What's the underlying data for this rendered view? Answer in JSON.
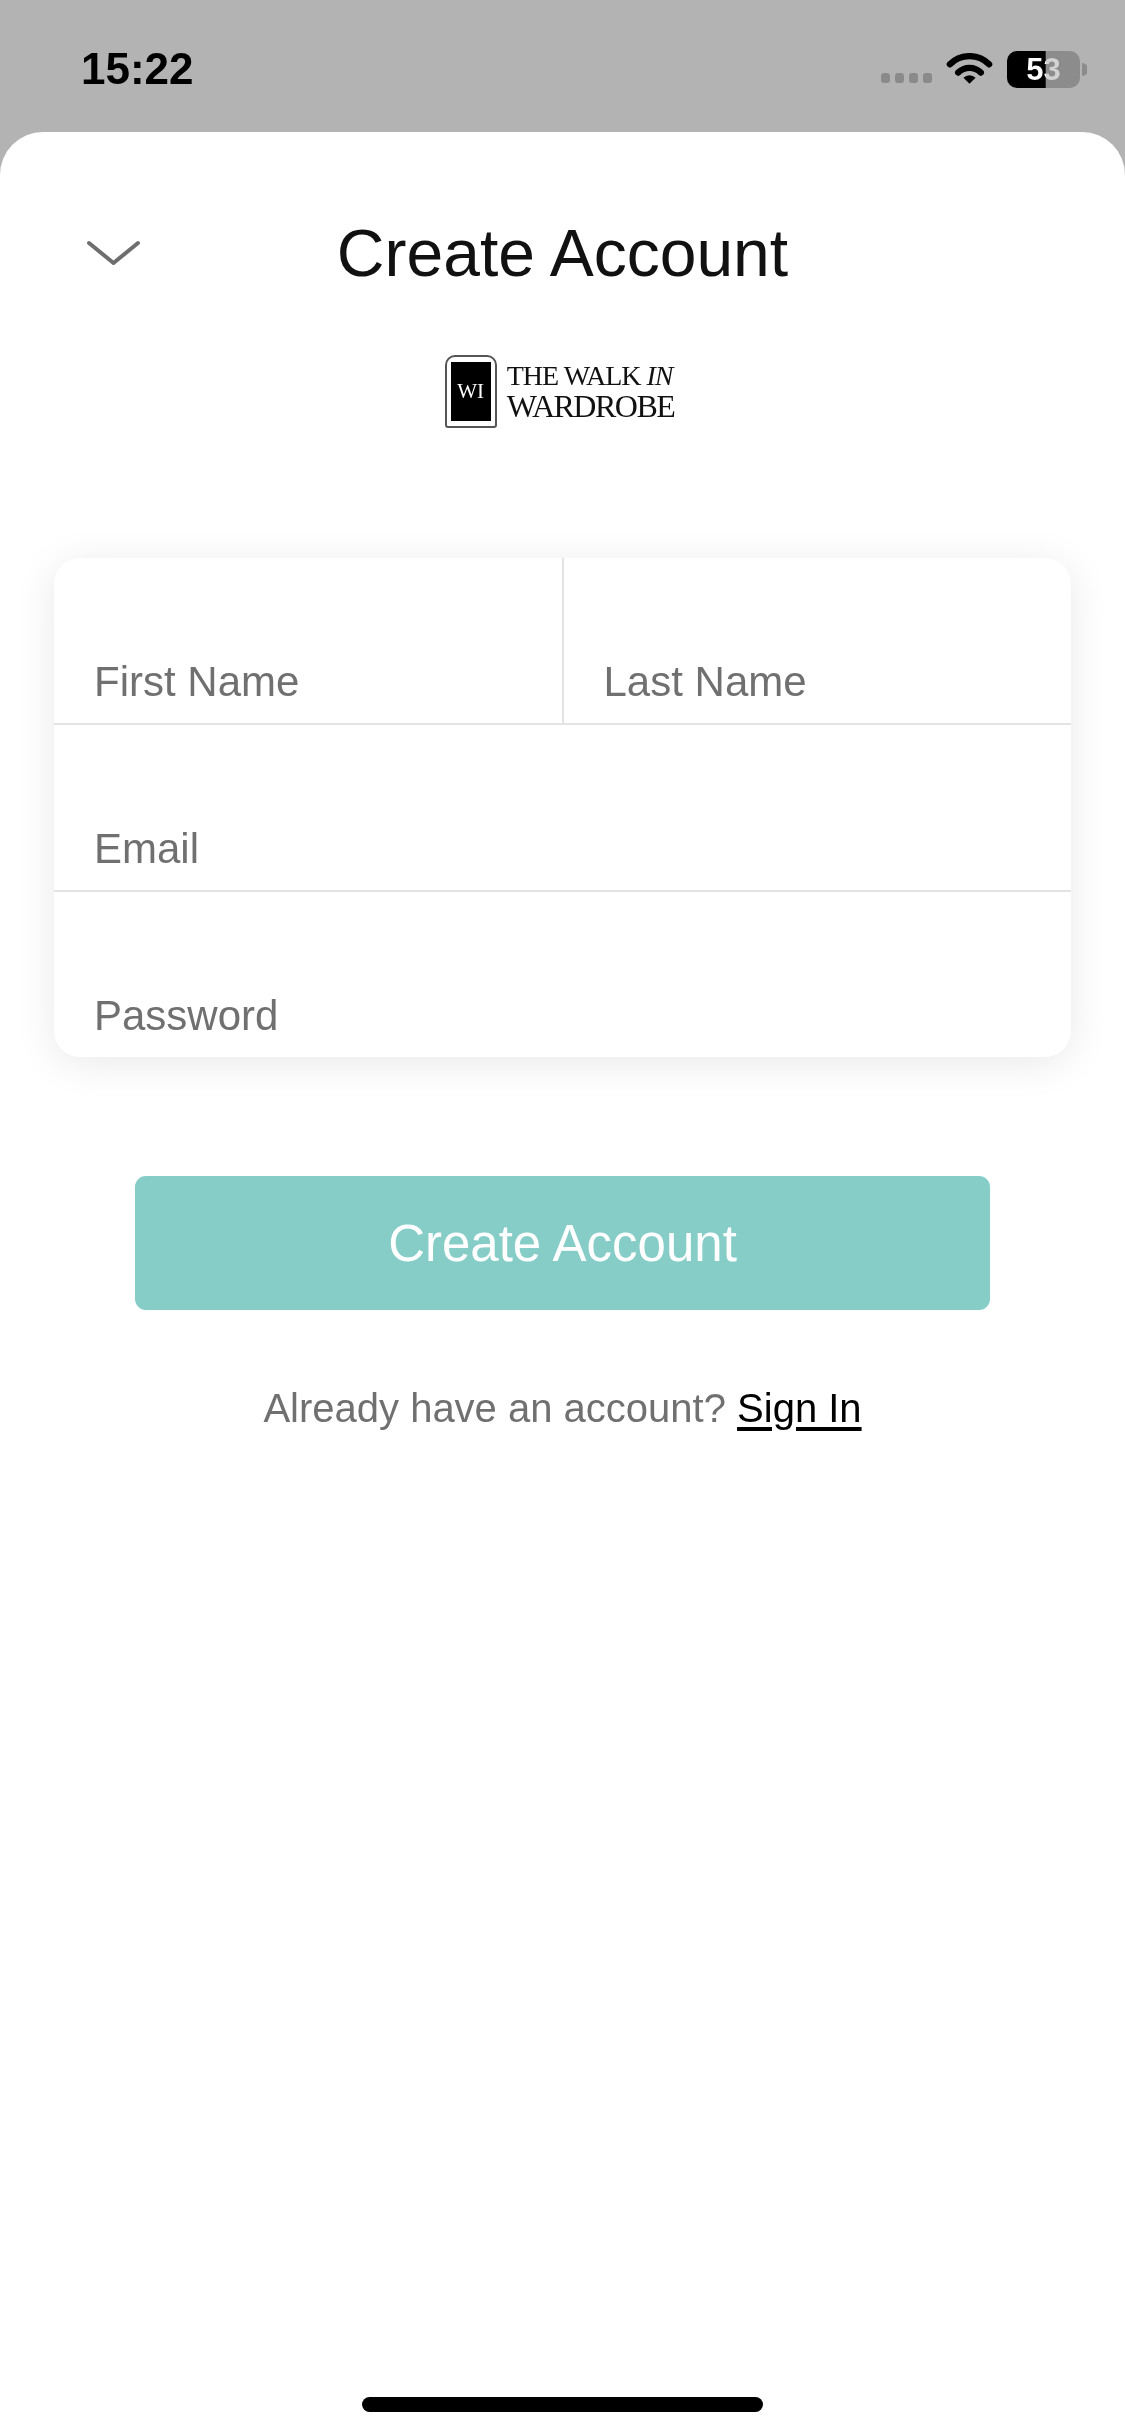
{
  "status_bar": {
    "time": "15:22",
    "battery": "53"
  },
  "header": {
    "title": "Create Account"
  },
  "logo": {
    "monogram": "WI",
    "lines": [
      "THE WALK *IN*",
      "WARDROBE"
    ]
  },
  "form": {
    "rows": [
      [
        {
          "placeholder": "First Name"
        },
        {
          "placeholder": "Last Name"
        }
      ],
      [
        {
          "placeholder": "Email"
        }
      ],
      [
        {
          "placeholder": "Password"
        }
      ]
    ]
  },
  "create_button": {
    "label": "Create Account"
  },
  "sign_in_prompt": {
    "text": "Already have an account?",
    "link": "Sign In"
  }
}
